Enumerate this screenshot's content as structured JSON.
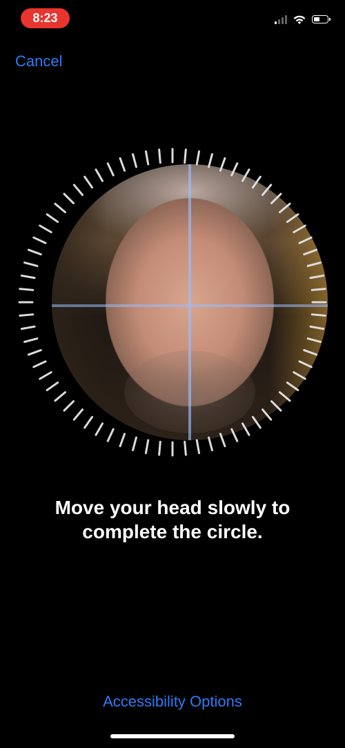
{
  "status_bar": {
    "time": "8:23",
    "recording_indicator_color": "#e8352e",
    "signal_icon": "cellular-signal-icon",
    "signal_bars_active": 1,
    "signal_bars_total": 4,
    "wifi_icon": "wifi-icon",
    "battery_icon": "battery-icon",
    "battery_level": 0.45
  },
  "nav": {
    "cancel_label": "Cancel",
    "accent_color": "#2f7cf6"
  },
  "scan": {
    "camera_view": "front-camera-face-preview",
    "guide": "crosshair-guide",
    "progress_ring": {
      "tick_count": 72,
      "completed_ticks": 0,
      "tick_color": "#dcdcdc",
      "guide_color": "#98beff"
    }
  },
  "instruction": {
    "line1": "Move your head slowly to",
    "line2": "complete the circle."
  },
  "footer": {
    "accessibility_label": "Accessibility Options"
  }
}
